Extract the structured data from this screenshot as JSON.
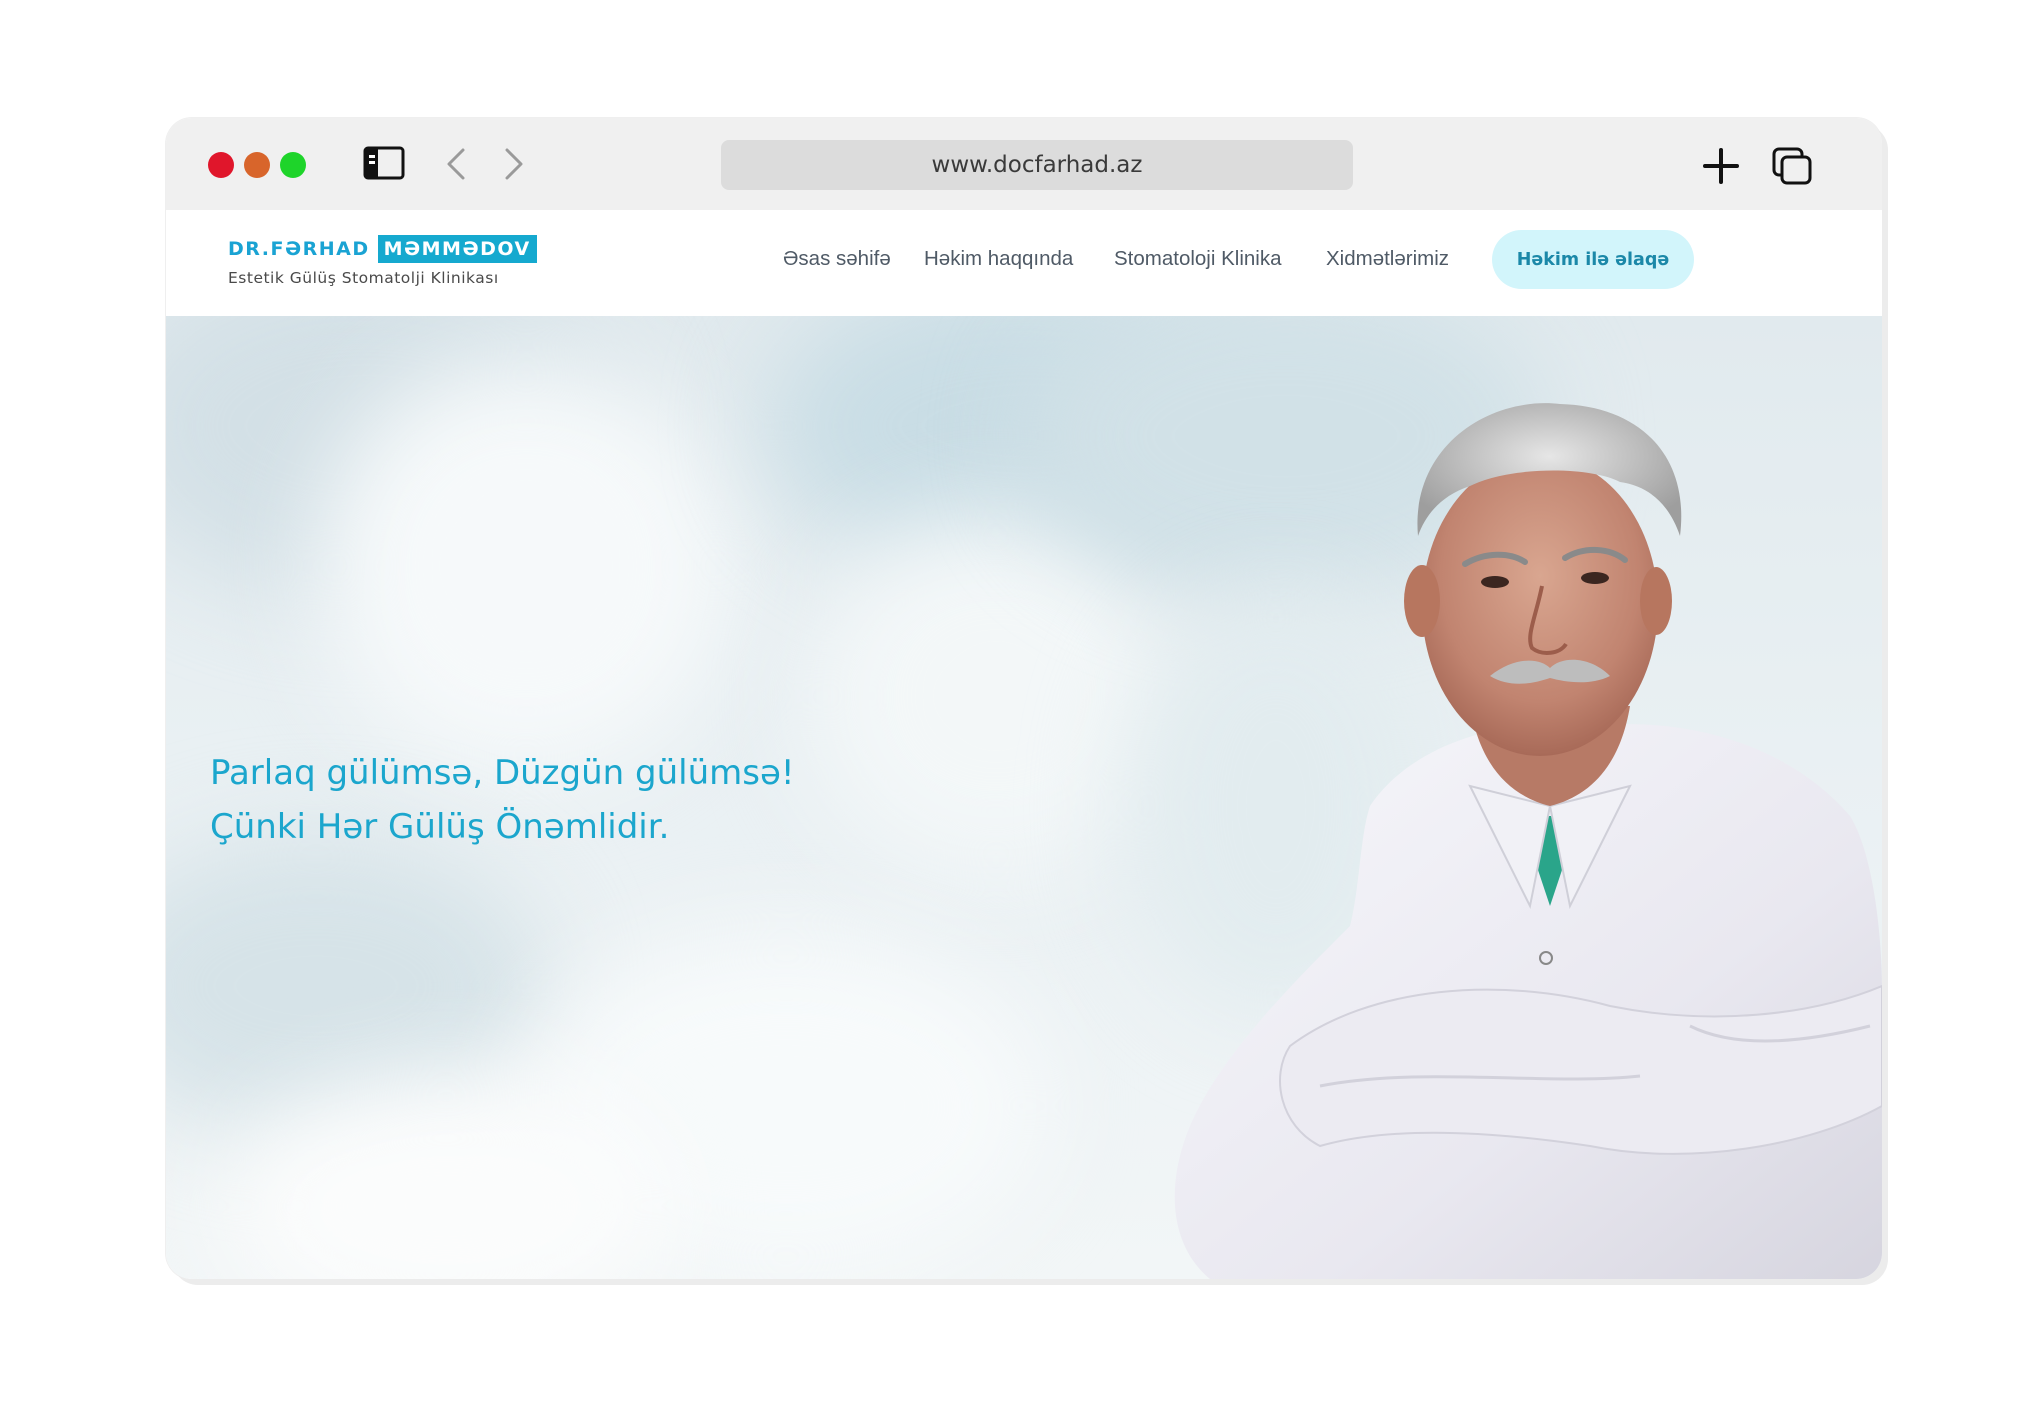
{
  "browser": {
    "url": "www.docfarhad.az"
  },
  "site": {
    "logo": {
      "first": "DR.FƏRHAD",
      "last": "MƏMMƏDOV",
      "subtitle": "Estetik Gülüş Stomatolji Klinikası"
    },
    "nav": [
      {
        "label": "Əsas səhifə"
      },
      {
        "label": "Həkim haqqında"
      },
      {
        "label": "Stomatoloji Klinika"
      },
      {
        "label": "Xidmətlərimiz"
      }
    ],
    "contact_button": "Həkim ilə əlaqə"
  },
  "hero": {
    "line1": "Parlaq gülümsə, Düzgün gülümsə!",
    "line2": "Çünki Hər Gülüş Önəmlidir."
  },
  "colors": {
    "brand": "#15a9cf",
    "button_bg": "#d2f5fb",
    "button_text": "#1b88a8",
    "traffic_red": "#e0162b",
    "traffic_orange": "#d8652b",
    "traffic_green": "#1ed42a"
  },
  "icons": [
    "sidebar-icon",
    "chevron-left-icon",
    "chevron-right-icon",
    "plus-icon",
    "tabs-icon"
  ]
}
